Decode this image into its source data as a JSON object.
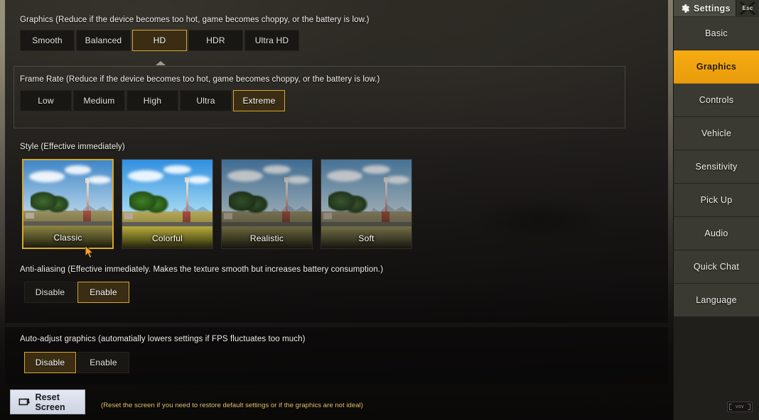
{
  "window": {
    "title": "Settings",
    "gear_icon": "gear-icon",
    "close_label": "Esc",
    "watermark": "vov"
  },
  "sidebar": {
    "items": [
      {
        "label": "Basic",
        "active": false
      },
      {
        "label": "Graphics",
        "active": true
      },
      {
        "label": "Controls",
        "active": false
      },
      {
        "label": "Vehicle",
        "active": false
      },
      {
        "label": "Sensitivity",
        "active": false
      },
      {
        "label": "Pick Up",
        "active": false
      },
      {
        "label": "Audio",
        "active": false
      },
      {
        "label": "Quick Chat",
        "active": false
      },
      {
        "label": "Language",
        "active": false
      }
    ]
  },
  "sections": {
    "graphics": {
      "label": "Graphics (Reduce if the device becomes too hot, game becomes choppy, or the battery is low.)",
      "options": [
        "Smooth",
        "Balanced",
        "HD",
        "HDR",
        "Ultra HD"
      ],
      "selected": "HD"
    },
    "frame_rate": {
      "label": "Frame Rate (Reduce if the device becomes too hot, game becomes choppy, or the battery is low.)",
      "options": [
        "Low",
        "Medium",
        "High",
        "Ultra",
        "Extreme"
      ],
      "selected": "Extreme"
    },
    "style": {
      "label": "Style (Effective immediately)",
      "options": [
        "Classic",
        "Colorful",
        "Realistic",
        "Soft"
      ],
      "selected": "Classic"
    },
    "anti_aliasing": {
      "label": "Anti-aliasing (Effective immediately. Makes the texture smooth but increases battery consumption.)",
      "options": [
        "Disable",
        "Enable"
      ],
      "selected": "Enable"
    },
    "auto_adjust": {
      "label": "Auto-adjust graphics (automatially lowers settings if FPS fluctuates too much)",
      "options": [
        "Disable",
        "Enable"
      ],
      "selected": "Disable"
    }
  },
  "reset": {
    "label": "Reset Screen",
    "icon": "reset-screen-icon",
    "hint": "(Reset the screen if you need to restore default settings or if the graphics are not ideal)"
  },
  "theme": {
    "accent": "#f5ab12",
    "selected_border": "#d8a72b",
    "selected_fill": "#3a2d14",
    "button_bg": "#191714",
    "hint_text": "#e3c36a",
    "sidebar_bg": "#3a3a33"
  },
  "style_previews": [
    {
      "name": "Classic",
      "sky_top": "#3f86c8",
      "sky_bot": "#b6d4e8",
      "grass1": "#8a8142",
      "grass2": "#6e6a33",
      "grass3": "#3d3c1e",
      "tree1": "#3f6b2e",
      "tree2": "#27431d",
      "mtn": "#8494a6",
      "road": "#5c5a52",
      "far1": "#9a9164",
      "far2": "#7e7748"
    },
    {
      "name": "Colorful",
      "sky_top": "#2f8ee0",
      "sky_bot": "#a8dcf4",
      "grass1": "#b4a53c",
      "grass2": "#8f8a2c",
      "grass3": "#4c4a1c",
      "tree1": "#3f8026",
      "tree2": "#275417",
      "mtn": "#7fa0bd",
      "road": "#5f5d55",
      "far1": "#b5a85c",
      "far2": "#968c42"
    },
    {
      "name": "Realistic",
      "sky_top": "#4b88bc",
      "sky_bot": "#bcd4e2",
      "grass1": "#837c48",
      "grass2": "#69653a",
      "grass3": "#3a3920",
      "tree1": "#3d6330",
      "tree2": "#25401e",
      "mtn": "#8a99a8",
      "road": "#5a5850",
      "far1": "#938c66",
      "far2": "#78734c"
    },
    {
      "name": "Soft",
      "sky_top": "#5590be",
      "sky_bot": "#c2d8e4",
      "grass1": "#8b8552",
      "grass2": "#706c42",
      "grass3": "#403e26",
      "tree1": "#456a36",
      "tree2": "#2a4422",
      "mtn": "#90a0ad",
      "road": "#5e5c55",
      "far1": "#988f6c",
      "far2": "#7d7756"
    }
  ]
}
